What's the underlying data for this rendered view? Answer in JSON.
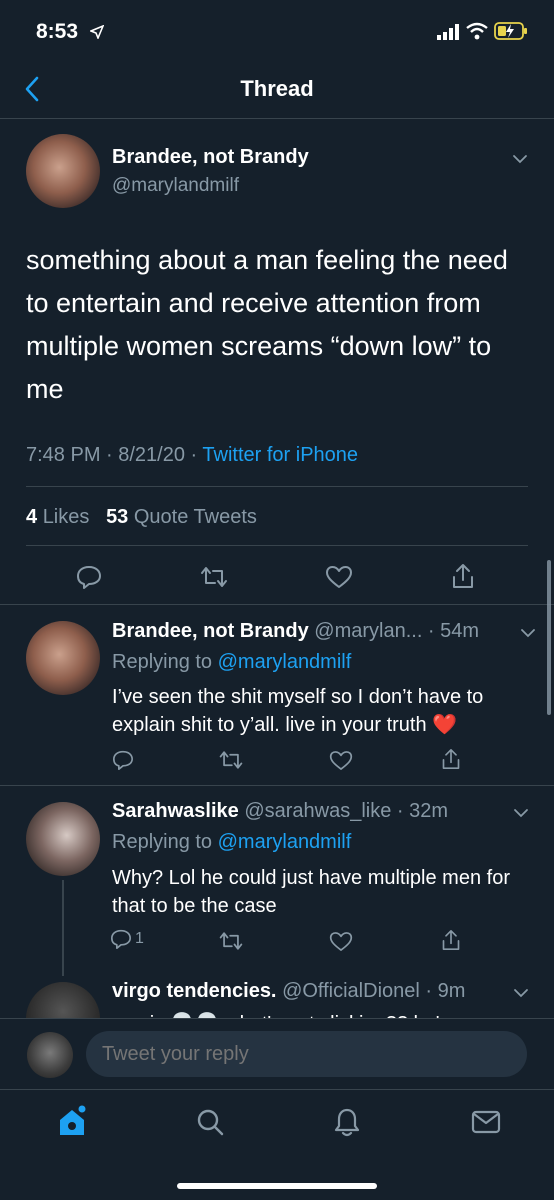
{
  "status_bar": {
    "time": "8:53"
  },
  "header": {
    "title": "Thread"
  },
  "main_tweet": {
    "name": "Brandee, not Brandy",
    "handle": "@marylandmilf",
    "text": "something about a man feeling the need to entertain and receive attention from multiple women screams “down low” to me",
    "time": "7:48 PM · 8/21/20 · ",
    "source": "Twitter for iPhone",
    "likes_count": "4",
    "likes_label": "Likes",
    "quotes_count": "53",
    "quotes_label": "Quote Tweets"
  },
  "replies": [
    {
      "name": "Brandee, not Brandy",
      "meta": "@marylan... · 54m",
      "replying_prefix": "Replying to ",
      "replying_to": "@marylandmilf",
      "text": "I’ve seen the shit myself so I don’t have to explain shit to y’all. live in your truth ❤️"
    },
    {
      "name": "Sarahwaslike",
      "meta": "@sarahwas_like · 32m",
      "replying_prefix": "Replying to ",
      "replying_to": "@marylandmilf",
      "text": "Why? Lol he could just have multiple men for that to be the case",
      "reply_count": "1"
    },
    {
      "name": "virgo tendencies.",
      "meta": "@OfficialDionel · 9m",
      "text": "no cis 💀💀 what's not clicking?? he's"
    }
  ],
  "composer": {
    "placeholder": "Tweet your reply"
  },
  "colors": {
    "background": "#15202b",
    "accent": "#1da1f2",
    "muted": "#8899a6",
    "divider": "#38444d"
  }
}
